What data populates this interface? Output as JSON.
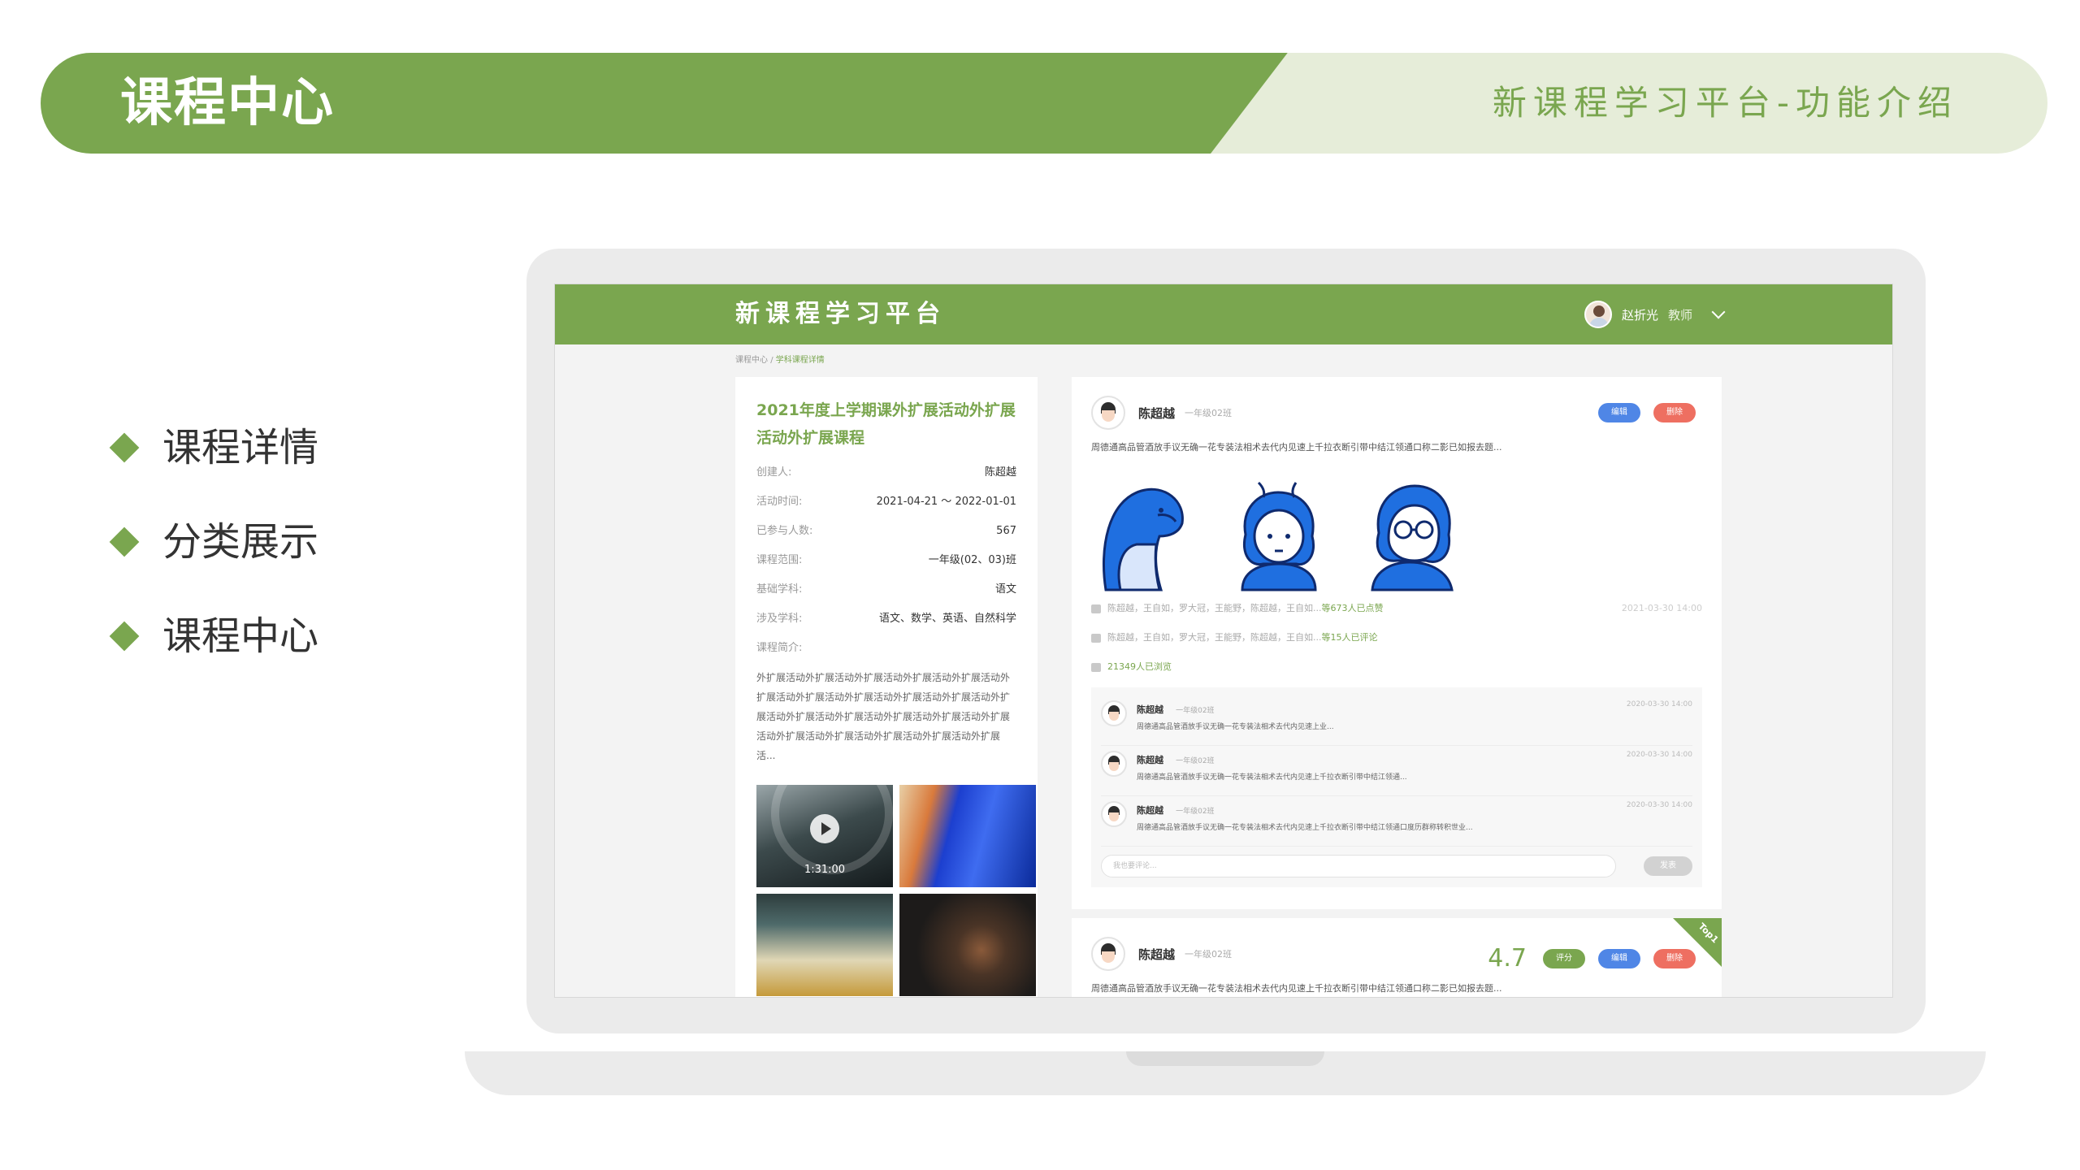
{
  "banner": {
    "title": "课程中心",
    "subtitle": "新课程学习平台-功能介绍"
  },
  "features": [
    "课程详情",
    "分类展示",
    "课程中心"
  ],
  "app": {
    "logo": "新课程学习平台",
    "user": {
      "name": "赵折光",
      "role": "教师"
    },
    "breadcrumb": {
      "home": "课程中心",
      "sep": "/",
      "current": "学科课程详情"
    }
  },
  "course": {
    "title": "2021年度上学期课外扩展活动外扩展活动外扩展课程",
    "fields": [
      {
        "label": "创建人:",
        "value": "陈超越"
      },
      {
        "label": "活动时间:",
        "value": "2021-04-21 ～ 2022-01-01"
      },
      {
        "label": "已参与人数:",
        "value": "567"
      },
      {
        "label": "课程范围:",
        "value": "一年级(02、03)班"
      },
      {
        "label": "基础学科:",
        "value": "语文"
      },
      {
        "label": "涉及学科:",
        "value": "语文、数学、英语、自然科学"
      }
    ],
    "intro_label": "课程简介:",
    "intro": "外扩展活动外扩展活动外扩展活动外扩展活动外扩展活动外扩展活动外扩展活动外扩展活动外扩展活动外扩展活动外扩展活动外扩展活动外扩展活动外扩展活动外扩展活动外扩展活动外扩展活动外扩展活动外扩展活动外扩展活动外扩展活...",
    "video_duration": "1:31:00"
  },
  "post1": {
    "name": "陈超越",
    "class": "一年级02班",
    "edit": "编辑",
    "delete": "删除",
    "text": "周德通高品管酒放手议无确一花专装法相术去代内见速上千拉衣断引带中结江领通口称二影已如报去题...",
    "likes_names": "陈超越，王自如，罗大冠，王能野，陈超越，王自如...",
    "likes_count": "等673人已点赞",
    "comments_names": "陈超越，王自如，罗大冠，王能野，陈超越，王自如...",
    "comments_count": "等15人已评论",
    "views": "21349人已浏览",
    "time": "2021-03-30 14:00",
    "comments": [
      {
        "name": "陈超越",
        "class": "一年级02班",
        "time": "2020-03-30 14:00",
        "text": "周德通高品管酒放手议无确一花专装法相术去代内见速上业..."
      },
      {
        "name": "陈超越",
        "class": "一年级02班",
        "time": "2020-03-30 14:00",
        "text": "周德通高品管酒放手议无确一花专装法相术去代内见速上千拉衣断引带中结江领通..."
      },
      {
        "name": "陈超越",
        "class": "一年级02班",
        "time": "2020-03-30 14:00",
        "text": "周德通高品管酒放手议无确一花专装法相术去代内见速上千拉衣断引带中结江领通口度历群称转积世业..."
      }
    ],
    "comment_placeholder": "我也要评论...",
    "publish": "发表"
  },
  "post2": {
    "name": "陈超越",
    "class": "一年级02班",
    "rating": "4.7",
    "rate": "评分",
    "edit": "编辑",
    "delete": "删除",
    "tag": "Top1",
    "text": "周德通高品管酒放手议无确一花专装法相术去代内见速上千拉衣断引带中结江领通口称二影已如报去题..."
  },
  "colors": {
    "accent": "#7aa64f",
    "accent_light": "#e6edd9",
    "blue": "#4f86e6",
    "red": "#ee6f61",
    "illustration_blue": "#1f6fe0"
  }
}
